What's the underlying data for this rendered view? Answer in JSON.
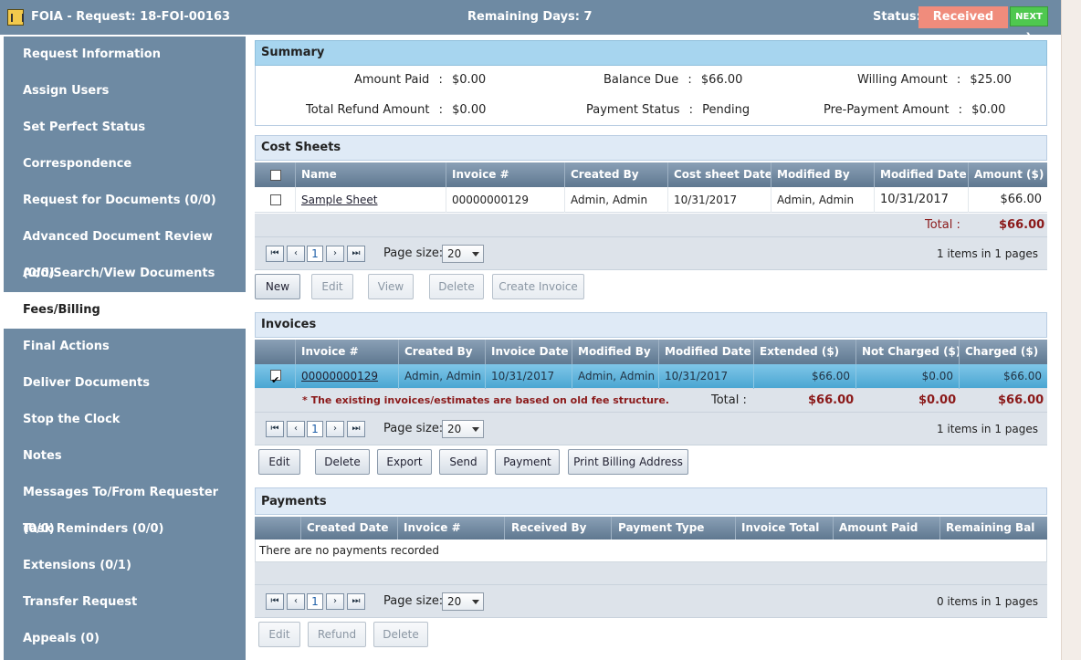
{
  "header": {
    "title": "FOIA - Request: 18-FOI-00163",
    "remaining": "Remaining Days: 7",
    "status_label": "Status:",
    "status_value": "Received",
    "next_label": "NEXT ❯"
  },
  "sidebar": {
    "items": [
      {
        "label": "Request Information"
      },
      {
        "label": "Assign Users"
      },
      {
        "label": "Set Perfect Status"
      },
      {
        "label": "Correspondence"
      },
      {
        "label": "Request for Documents (0/0)"
      },
      {
        "label": "Advanced Document Review (0/0)"
      },
      {
        "label": "Add/Search/View Documents (0/0)"
      },
      {
        "label": "Fees/Billing"
      },
      {
        "label": "Final Actions"
      },
      {
        "label": "Deliver Documents"
      },
      {
        "label": "Stop the Clock"
      },
      {
        "label": "Notes"
      },
      {
        "label": "Messages To/From Requester (0/0)"
      },
      {
        "label": "Task Reminders (0/0)"
      },
      {
        "label": "Extensions (0/1)"
      },
      {
        "label": "Transfer Request"
      },
      {
        "label": "Appeals (0)"
      }
    ]
  },
  "summary": {
    "title": "Summary",
    "amount_paid_label": "Amount Paid",
    "amount_paid": "$0.00",
    "balance_due_label": "Balance Due",
    "balance_due": "$66.00",
    "willing_amount_label": "Willing Amount",
    "willing_amount": "$25.00",
    "total_refund_label": "Total Refund Amount",
    "total_refund": "$0.00",
    "payment_status_label": "Payment Status",
    "payment_status": "Pending",
    "prepayment_label": "Pre-Payment Amount",
    "prepayment": "$0.00",
    "sep": ":"
  },
  "cost_sheets": {
    "title": "Cost Sheets",
    "columns": [
      "Name",
      "Invoice #",
      "Created By",
      "Cost sheet Date",
      "Modified By",
      "Modified Date",
      "Amount ($)"
    ],
    "rows": [
      {
        "name": "Sample Sheet",
        "invoice": "00000000129",
        "created_by": "Admin, Admin",
        "date": "10/31/2017",
        "modified_by": "Admin, Admin",
        "modified_date": "10/31/2017",
        "amount": "$66.00"
      }
    ],
    "total_label": "Total :",
    "total_value": "$66.00",
    "page_size_label": "Page size:",
    "page_size": "20",
    "page_current": "1",
    "page_info": "1 items in 1 pages",
    "buttons": {
      "new": "New",
      "edit": "Edit",
      "view": "View",
      "delete": "Delete",
      "create_invoice": "Create Invoice"
    }
  },
  "invoices": {
    "title": "Invoices",
    "columns": [
      "Invoice #",
      "Created By",
      "Invoice Date",
      "Modified By",
      "Modified Date",
      "Extended ($)",
      "Not Charged ($)",
      "Charged ($)"
    ],
    "rows": [
      {
        "invoice": "00000000129",
        "created_by": "Admin, Admin",
        "date": "10/31/2017",
        "modified_by": "Admin, Admin",
        "modified_date": "10/31/2017",
        "extended": "$66.00",
        "not_charged": "$0.00",
        "charged": "$66.00"
      }
    ],
    "note": "* The existing invoices/estimates are based on old fee structure.",
    "total_label": "Total :",
    "total_extended": "$66.00",
    "total_not_charged": "$0.00",
    "total_charged": "$66.00",
    "page_size_label": "Page size:",
    "page_size": "20",
    "page_current": "1",
    "page_info": "1 items in 1 pages",
    "buttons": {
      "edit": "Edit",
      "delete": "Delete",
      "export": "Export",
      "send": "Send",
      "payment": "Payment",
      "print": "Print Billing Address"
    }
  },
  "payments": {
    "title": "Payments",
    "columns": [
      "Created Date",
      "Invoice #",
      "Received By",
      "Payment Type",
      "Invoice Total",
      "Amount Paid",
      "Remaining Bal"
    ],
    "empty": "There are no payments recorded",
    "page_size_label": "Page size:",
    "page_size": "20",
    "page_current": "1",
    "page_info": "0 items in 1 pages",
    "buttons": {
      "edit": "Edit",
      "refund": "Refund",
      "delete": "Delete"
    }
  },
  "pager_icons": {
    "first": "⏮",
    "prev": "‹",
    "next": "›",
    "last": "⏭"
  }
}
